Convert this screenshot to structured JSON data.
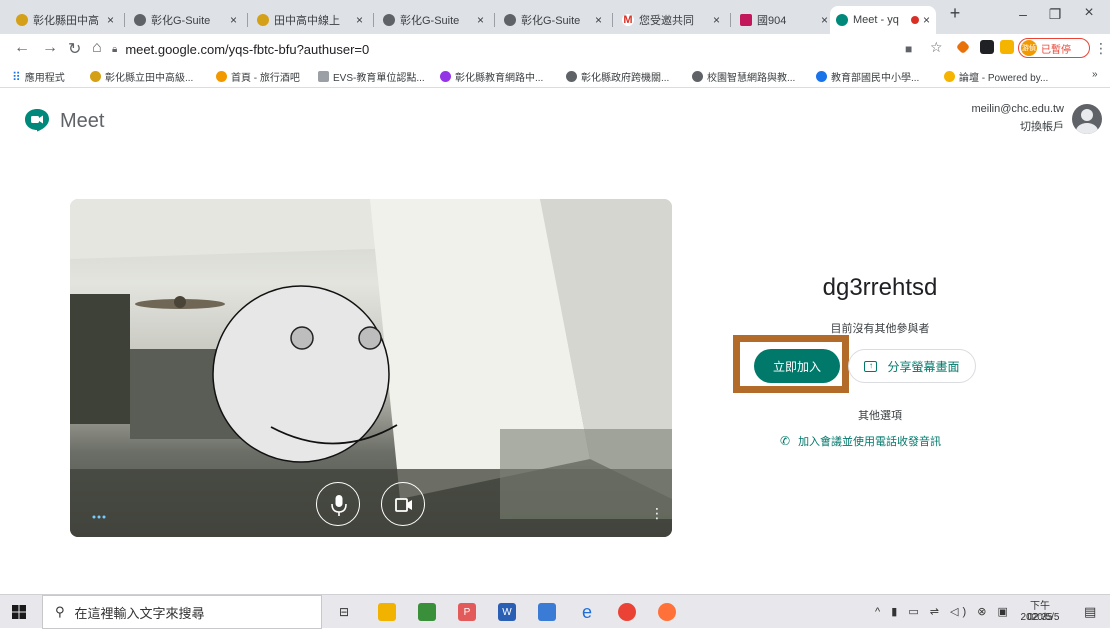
{
  "browser": {
    "tabs": [
      {
        "title": "彰化縣田中高",
        "color": "#d4a017"
      },
      {
        "title": "彰化G-Suite",
        "color": "#5f6368"
      },
      {
        "title": "田中高中線上",
        "color": "#d4a017"
      },
      {
        "title": "彰化G-Suite",
        "color": "#5f6368"
      },
      {
        "title": "彰化G-Suite",
        "color": "#5f6368"
      },
      {
        "title": "您受邀共同",
        "color": "#d93025"
      },
      {
        "title": "國904",
        "color": "#c2185b"
      },
      {
        "title": "Meet - yq",
        "color": "#00897b"
      }
    ],
    "new_tab": "+",
    "win_min": "–",
    "win_restore": "❐",
    "win_close": "×",
    "url": "meet.google.com/yqs-fbtc-bfu?authuser=0",
    "paused_label": "已暫停",
    "paused_avatar_text": "游偵",
    "bookmarks": [
      {
        "label": "應用程式",
        "color": "#1a73e8"
      },
      {
        "label": "彰化縣立田中高級...",
        "color": "#d4a017"
      },
      {
        "label": "首頁 - 旅行酒吧",
        "color": "#f29900"
      },
      {
        "label": "EVS-教育單位認點...",
        "color": "#9aa0a6"
      },
      {
        "label": "彰化縣教育網路中...",
        "color": "#9334e6"
      },
      {
        "label": "彰化縣政府跨機關...",
        "color": "#5f6368"
      },
      {
        "label": "校園智慧網路與教...",
        "color": "#5f6368"
      },
      {
        "label": "教育部國民中小學...",
        "color": "#1a73e8"
      },
      {
        "label": "論壇 - Powered by...",
        "color": "#f4b400"
      }
    ],
    "bookmarks_more": "»"
  },
  "meet": {
    "title": "Meet",
    "account_email": "meilin@chc.edu.tw",
    "account_switch": "切換帳戶",
    "room_name": "dg3rrehtsd",
    "no_participants": "目前沒有其他參與者",
    "join_label": "立即加入",
    "present_label": "分享螢幕畫面",
    "other_options": "其他選項",
    "phone_label": "加入會議並使用電話收發音訊",
    "accent_color": "#00796b",
    "highlight_color": "#b26b29"
  },
  "taskbar": {
    "search_placeholder": "在這裡輸入文字來搜尋",
    "time": "下午 02:35",
    "date": "2020/5/5"
  }
}
